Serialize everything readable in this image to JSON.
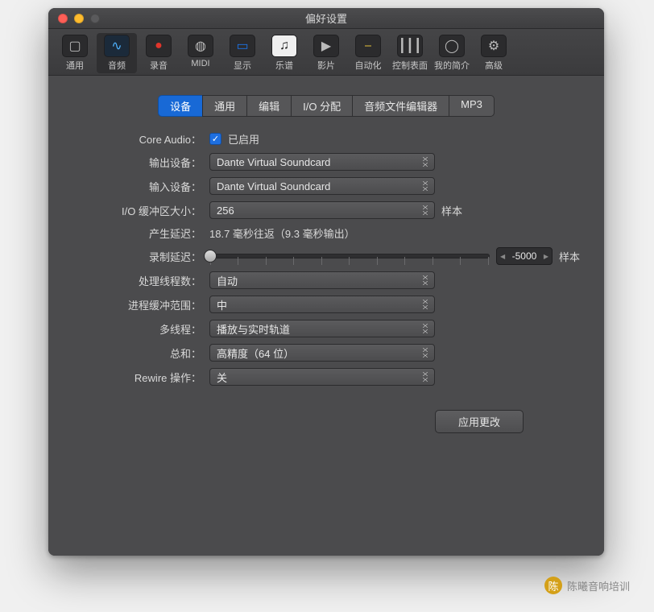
{
  "window": {
    "title": "偏好设置"
  },
  "toolbar": {
    "items": [
      {
        "label": "通用",
        "icon": "▢",
        "name": "general"
      },
      {
        "label": "音频",
        "icon": "∿",
        "name": "audio",
        "selected": true
      },
      {
        "label": "录音",
        "icon": "●",
        "name": "record",
        "color": "#e0352b"
      },
      {
        "label": "MIDI",
        "icon": "◍",
        "name": "midi"
      },
      {
        "label": "显示",
        "icon": "▭",
        "name": "display",
        "color": "#1e74e8"
      },
      {
        "label": "乐谱",
        "icon": "♫",
        "name": "score",
        "bg": "#efefef",
        "fg": "#222"
      },
      {
        "label": "影片",
        "icon": "▶",
        "name": "video"
      },
      {
        "label": "自动化",
        "icon": "⎯",
        "name": "automation",
        "fg": "#e6c13c"
      },
      {
        "label": "控制表面",
        "icon": "┃┃┃",
        "name": "control-surfaces"
      },
      {
        "label": "我的简介",
        "icon": "◯",
        "name": "my-info"
      },
      {
        "label": "高级",
        "icon": "⚙",
        "name": "advanced"
      }
    ]
  },
  "subtabs": [
    {
      "label": "设备",
      "active": true
    },
    {
      "label": "通用"
    },
    {
      "label": "编辑"
    },
    {
      "label": "I/O 分配"
    },
    {
      "label": "音频文件编辑器"
    },
    {
      "label": "MP3"
    }
  ],
  "form": {
    "core_audio": {
      "label": "Core Audio：",
      "enabled_text": "已启用",
      "checked": true
    },
    "output_device": {
      "label": "输出设备：",
      "value": "Dante Virtual Soundcard"
    },
    "input_device": {
      "label": "输入设备：",
      "value": "Dante Virtual Soundcard"
    },
    "io_buffer": {
      "label": "I/O 缓冲区大小：",
      "value": "256",
      "unit": "样本"
    },
    "latency": {
      "label": "产生延迟：",
      "text": "18.7 毫秒往返（9.3 毫秒输出）"
    },
    "record_delay": {
      "label": "录制延迟：",
      "value": "-5000",
      "unit": "样本"
    },
    "threads": {
      "label": "处理线程数：",
      "value": "自动"
    },
    "process_buffer": {
      "label": "进程缓冲范围：",
      "value": "中"
    },
    "multithread": {
      "label": "多线程：",
      "value": "播放与实时轨道"
    },
    "summing": {
      "label": "总和：",
      "value": "高精度（64 位）"
    },
    "rewire": {
      "label": "Rewire 操作：",
      "value": "关"
    },
    "apply": "应用更改"
  },
  "footer": {
    "brand": "陈曦音响培训"
  }
}
